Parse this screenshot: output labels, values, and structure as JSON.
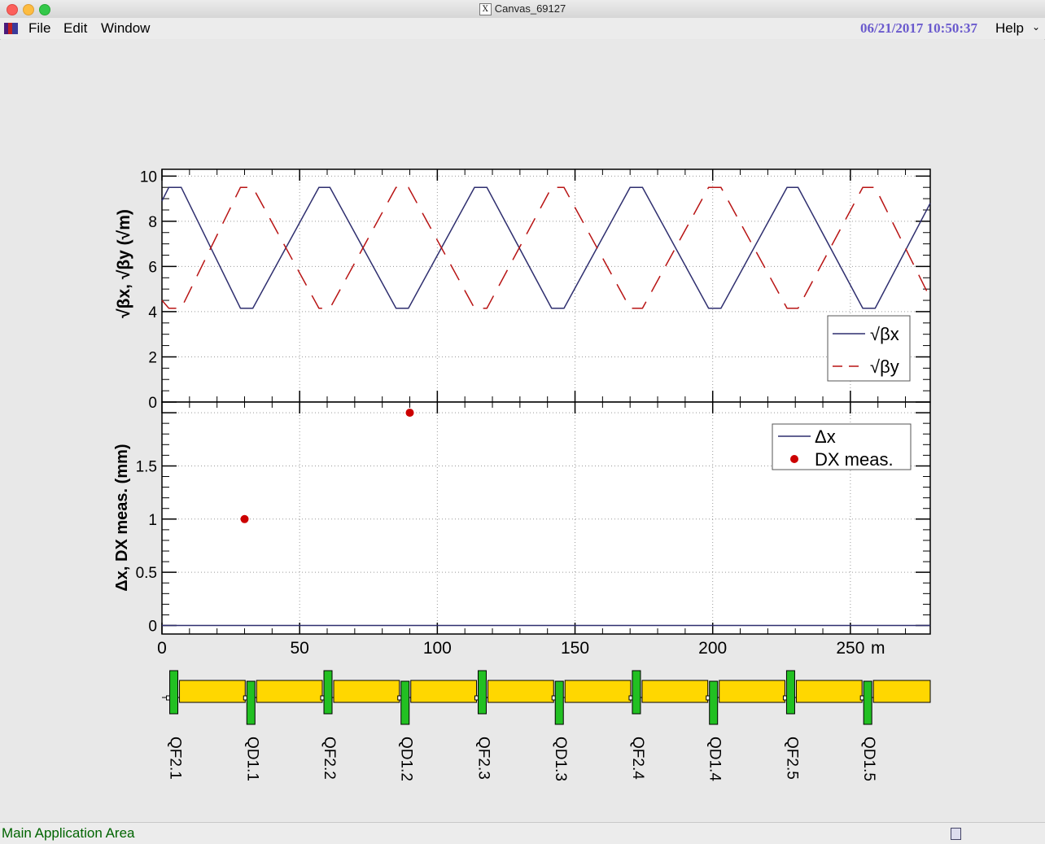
{
  "window": {
    "title": "Canvas_69127",
    "title_icon": "x11-icon"
  },
  "menubar": {
    "items": [
      {
        "label": "File",
        "accel": "F"
      },
      {
        "label": "Edit",
        "accel": "E"
      },
      {
        "label": "Window",
        "accel": "W"
      }
    ],
    "datetime": "06/21/2017 10:50:37",
    "help": "Help",
    "app_icon": "root-icon"
  },
  "statusbar": {
    "text": "Main Application Area",
    "icon": "document-icon"
  },
  "colors": {
    "beta_x": "#2f2f6f",
    "beta_y": "#b81414",
    "dx_meas": "#cc0000",
    "quad_f": "#22c022",
    "dipole": "#ffd700"
  },
  "chart_data": [
    {
      "type": "line",
      "ylabel": "√βx, √βy (√m)",
      "ylim": [
        0,
        10
      ],
      "yticks": [
        0,
        2,
        4,
        6,
        8,
        10
      ],
      "grid": true,
      "legend": {
        "placement": "right",
        "entries": [
          "√βx",
          "√βy"
        ]
      },
      "series": [
        {
          "name": "√βx",
          "style": "solid",
          "x": [
            0,
            2.5,
            7,
            28.5,
            33,
            57,
            61,
            85,
            89.5,
            113.5,
            118,
            141.5,
            146,
            170,
            174.5,
            198.5,
            203,
            227,
            231,
            254.5,
            259,
            279
          ],
          "y": [
            8.9,
            9.5,
            9.5,
            4.15,
            4.15,
            9.5,
            9.5,
            4.15,
            4.15,
            9.5,
            9.5,
            4.15,
            4.15,
            9.5,
            9.5,
            4.15,
            4.15,
            9.5,
            9.5,
            4.15,
            4.15,
            8.8
          ]
        },
        {
          "name": "√βy",
          "style": "dashed",
          "x": [
            0,
            2.5,
            7,
            28.5,
            33,
            57,
            61,
            85,
            89.5,
            113.5,
            118,
            141.5,
            146,
            170,
            174.5,
            198.5,
            203,
            227,
            231,
            254.5,
            259,
            279
          ],
          "y": [
            4.5,
            4.15,
            4.15,
            9.5,
            9.5,
            4.15,
            4.15,
            9.5,
            9.5,
            4.15,
            4.15,
            9.5,
            9.5,
            4.15,
            4.15,
            9.5,
            9.5,
            4.15,
            4.15,
            9.5,
            9.5,
            4.6
          ]
        }
      ]
    },
    {
      "type": "scatter",
      "ylabel": "Δx, DX meas. (mm)",
      "xlabel_unit": "m",
      "ylim": [
        -0.08,
        2.1
      ],
      "yticks": [
        "0",
        "0.5",
        "1",
        "1.5"
      ],
      "xlim": [
        0,
        279
      ],
      "xticks": [
        "0",
        "50",
        "100",
        "150",
        "200",
        "250"
      ],
      "grid": true,
      "legend": {
        "placement": "top-right",
        "entries": [
          "Δx",
          "DX meas."
        ]
      },
      "series": [
        {
          "name": "Δx",
          "style": "solid",
          "x": [
            0,
            279
          ],
          "y": [
            0,
            0
          ]
        },
        {
          "name": "DX meas.",
          "style": "markers",
          "x": [
            30,
            90
          ],
          "y": [
            1.0,
            2.0
          ]
        }
      ]
    }
  ],
  "lattice": {
    "elements": [
      {
        "name": "QF2.1",
        "type": "F",
        "s": 4
      },
      {
        "name": "QD1.1",
        "type": "D",
        "s": 32
      },
      {
        "name": "QF2.2",
        "type": "F",
        "s": 60
      },
      {
        "name": "QD1.2",
        "type": "D",
        "s": 88
      },
      {
        "name": "QF2.3",
        "type": "F",
        "s": 116
      },
      {
        "name": "QD1.3",
        "type": "D",
        "s": 144
      },
      {
        "name": "QF2.4",
        "type": "F",
        "s": 172
      },
      {
        "name": "QD1.4",
        "type": "D",
        "s": 200
      },
      {
        "name": "QF2.5",
        "type": "F",
        "s": 228
      },
      {
        "name": "QD1.5",
        "type": "D",
        "s": 256
      }
    ]
  }
}
